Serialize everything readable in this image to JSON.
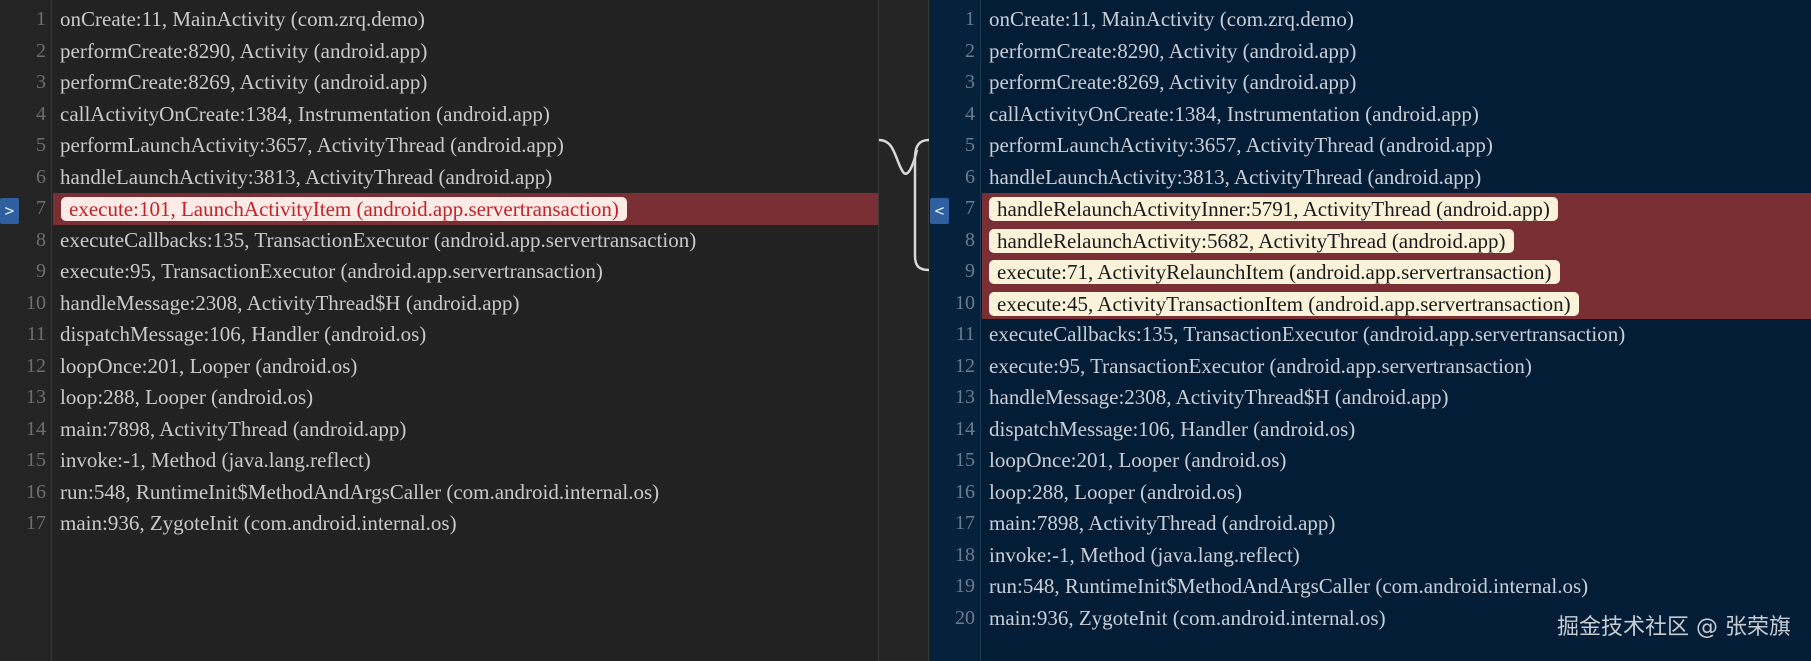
{
  "left": {
    "marker": ">",
    "lines": [
      {
        "num": "1",
        "text": "onCreate:11, MainActivity (com.zrq.demo)",
        "changed": false
      },
      {
        "num": "2",
        "text": "performCreate:8290, Activity (android.app)",
        "changed": false
      },
      {
        "num": "3",
        "text": "performCreate:8269, Activity (android.app)",
        "changed": false
      },
      {
        "num": "4",
        "text": "callActivityOnCreate:1384, Instrumentation (android.app)",
        "changed": false
      },
      {
        "num": "5",
        "text": "performLaunchActivity:3657, ActivityThread (android.app)",
        "changed": false
      },
      {
        "num": "6",
        "text": "handleLaunchActivity:3813, ActivityThread (android.app)",
        "changed": false
      },
      {
        "num": "7",
        "text": "execute:101, LaunchActivityItem (android.app.servertransaction)",
        "changed": true
      },
      {
        "num": "8",
        "text": "executeCallbacks:135, TransactionExecutor (android.app.servertransaction)",
        "changed": false
      },
      {
        "num": "9",
        "text": "execute:95, TransactionExecutor (android.app.servertransaction)",
        "changed": false
      },
      {
        "num": "10",
        "text": "handleMessage:2308, ActivityThread$H (android.app)",
        "changed": false
      },
      {
        "num": "11",
        "text": "dispatchMessage:106, Handler (android.os)",
        "changed": false
      },
      {
        "num": "12",
        "text": "loopOnce:201, Looper (android.os)",
        "changed": false
      },
      {
        "num": "13",
        "text": "loop:288, Looper (android.os)",
        "changed": false
      },
      {
        "num": "14",
        "text": "main:7898, ActivityThread (android.app)",
        "changed": false
      },
      {
        "num": "15",
        "text": "invoke:-1, Method (java.lang.reflect)",
        "changed": false
      },
      {
        "num": "16",
        "text": "run:548, RuntimeInit$MethodAndArgsCaller (com.android.internal.os)",
        "changed": false
      },
      {
        "num": "17",
        "text": "main:936, ZygoteInit (com.android.internal.os)",
        "changed": false
      }
    ]
  },
  "right": {
    "marker": "<",
    "lines": [
      {
        "num": "1",
        "text": "onCreate:11, MainActivity (com.zrq.demo)",
        "changed": false
      },
      {
        "num": "2",
        "text": "performCreate:8290, Activity (android.app)",
        "changed": false
      },
      {
        "num": "3",
        "text": "performCreate:8269, Activity (android.app)",
        "changed": false
      },
      {
        "num": "4",
        "text": "callActivityOnCreate:1384, Instrumentation (android.app)",
        "changed": false
      },
      {
        "num": "5",
        "text": "performLaunchActivity:3657, ActivityThread (android.app)",
        "changed": false
      },
      {
        "num": "6",
        "text": "handleLaunchActivity:3813, ActivityThread (android.app)",
        "changed": false
      },
      {
        "num": "7",
        "text": "handleRelaunchActivityInner:5791, ActivityThread (android.app)",
        "changed": true
      },
      {
        "num": "8",
        "text": "handleRelaunchActivity:5682, ActivityThread (android.app)",
        "changed": true
      },
      {
        "num": "9",
        "text": "execute:71, ActivityRelaunchItem (android.app.servertransaction)",
        "changed": true
      },
      {
        "num": "10",
        "text": "execute:45, ActivityTransactionItem (android.app.servertransaction)",
        "changed": true
      },
      {
        "num": "11",
        "text": "executeCallbacks:135, TransactionExecutor (android.app.servertransaction)",
        "changed": false
      },
      {
        "num": "12",
        "text": "execute:95, TransactionExecutor (android.app.servertransaction)",
        "changed": false
      },
      {
        "num": "13",
        "text": "handleMessage:2308, ActivityThread$H (android.app)",
        "changed": false
      },
      {
        "num": "14",
        "text": "dispatchMessage:106, Handler (android.os)",
        "changed": false
      },
      {
        "num": "15",
        "text": "loopOnce:201, Looper (android.os)",
        "changed": false
      },
      {
        "num": "16",
        "text": "loop:288, Looper (android.os)",
        "changed": false
      },
      {
        "num": "17",
        "text": "main:7898, ActivityThread (android.app)",
        "changed": false
      },
      {
        "num": "18",
        "text": "invoke:-1, Method (java.lang.reflect)",
        "changed": false
      },
      {
        "num": "19",
        "text": "run:548, RuntimeInit$MethodAndArgsCaller (com.android.internal.os)",
        "changed": false
      },
      {
        "num": "20",
        "text": "main:936, ZygoteInit (com.android.internal.os)",
        "changed": false
      }
    ]
  },
  "watermark": "掘金技术社区 @ 张荣旗",
  "colors": {
    "left_changed_row": "#7a2f34",
    "right_changed_row": "#7a2f34",
    "left_changed_text": "#c0242b",
    "right_changed_text": "#1a1a1a",
    "marker": "#2f5f9e"
  }
}
